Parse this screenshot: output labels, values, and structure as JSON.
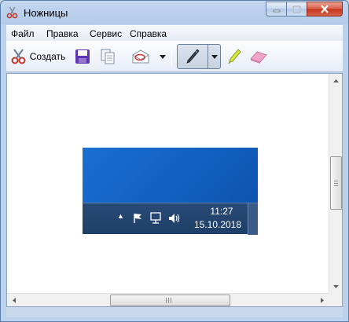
{
  "window": {
    "title": "Ножницы",
    "icon": "scissors-icon"
  },
  "menu": [
    "Файл",
    "Правка",
    "Сервис",
    "Справка"
  ],
  "toolbar": {
    "new_label": "Создать",
    "new_icon": "scissors-icon",
    "save_icon": "floppy-disk-icon",
    "copy_icon": "copy-icon",
    "send_icon": "envelope-icon",
    "pen_icon": "pen-icon",
    "highlighter_icon": "highlighter-icon",
    "eraser_icon": "eraser-icon"
  },
  "capture": {
    "time": "11:27",
    "date": "15.10.2018"
  },
  "colors": {
    "accent": "#1260c0",
    "taskbar": "#1e3f68",
    "close": "#c4331c"
  }
}
